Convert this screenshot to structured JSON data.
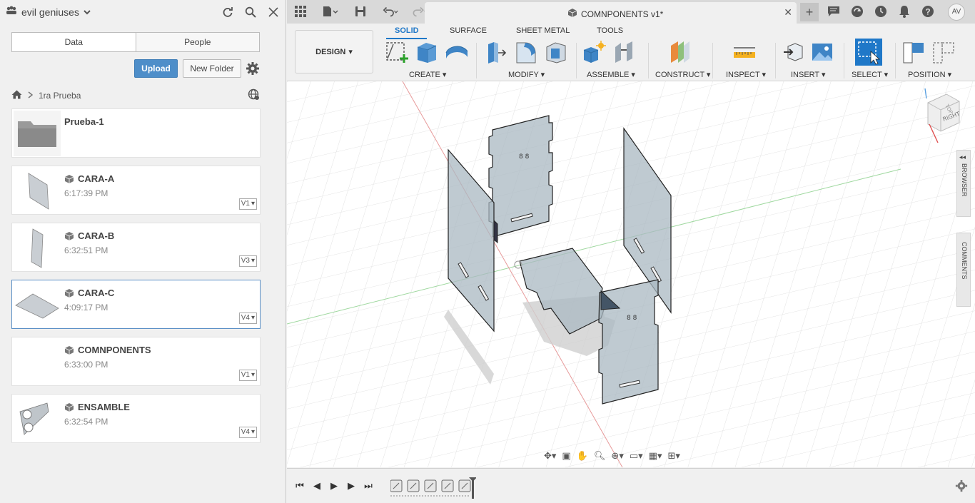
{
  "panel": {
    "team_name": "evil geniuses",
    "tabs": [
      {
        "label": "Data"
      },
      {
        "label": "People"
      }
    ],
    "upload_label": "Upload",
    "new_folder_label": "New Folder",
    "breadcrumb": "1ra Prueba",
    "items": [
      {
        "name": "Prueba-1",
        "type": "folder"
      },
      {
        "name": "CARA-A",
        "time": "6:17:39 PM",
        "version": "V1"
      },
      {
        "name": "CARA-B",
        "time": "6:32:51 PM",
        "version": "V3"
      },
      {
        "name": "CARA-C",
        "time": "4:09:17 PM",
        "version": "V4"
      },
      {
        "name": "COMNPONENTS",
        "time": "6:33:00 PM",
        "version": "V1"
      },
      {
        "name": "ENSAMBLE",
        "time": "6:32:54 PM",
        "version": "V4"
      }
    ]
  },
  "document": {
    "title": "COMNPONENTS v1*"
  },
  "user": {
    "initials": "AV"
  },
  "toolbar": {
    "design_label": "DESIGN",
    "tabs": [
      {
        "label": "SOLID"
      },
      {
        "label": "SURFACE"
      },
      {
        "label": "SHEET METAL"
      },
      {
        "label": "TOOLS"
      }
    ],
    "groups": [
      {
        "label": "CREATE"
      },
      {
        "label": "MODIFY"
      },
      {
        "label": "ASSEMBLE"
      },
      {
        "label": "CONSTRUCT"
      },
      {
        "label": "INSPECT"
      },
      {
        "label": "INSERT"
      },
      {
        "label": "SELECT"
      },
      {
        "label": "POSITION"
      }
    ]
  },
  "side_tabs": {
    "browser": "BROWSER",
    "comments": "COMMENTS"
  },
  "viewcube": {
    "face": "RIGHT",
    "top": "TOP"
  },
  "colors": {
    "accent": "#1f78c8",
    "upload": "#4e8ec9",
    "panel_fill": "#aab8c2"
  }
}
